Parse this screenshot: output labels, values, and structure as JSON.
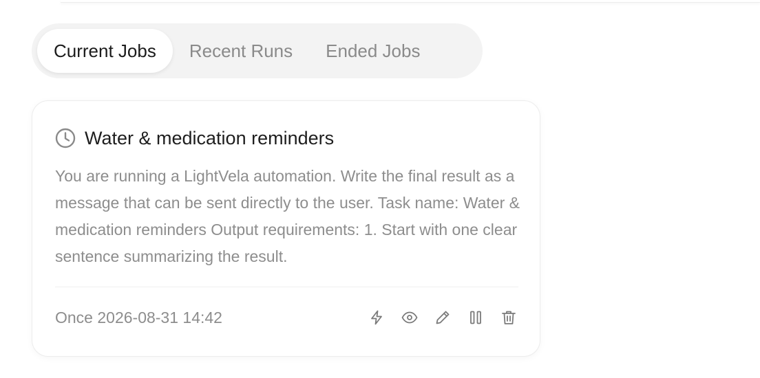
{
  "tabs": [
    {
      "label": "Current Jobs",
      "active": true
    },
    {
      "label": "Recent Runs",
      "active": false
    },
    {
      "label": "Ended Jobs",
      "active": false
    }
  ],
  "job": {
    "icon": "clock-icon",
    "title": "Water & medication reminders",
    "description": "You are running a LightVela automation. Write the final result as a message that can be sent directly to the user. Task name: Water & medication reminders Output requirements: 1. Start with one clear sentence summarizing the result.",
    "schedule": "Once 2026-08-31 14:42",
    "actions": [
      "run-now-icon",
      "view-icon",
      "edit-icon",
      "pause-icon",
      "delete-icon"
    ]
  },
  "colors": {
    "tab_bg": "#f3f3f3",
    "active_tab_bg": "#ffffff",
    "muted_text": "#8d8d8d",
    "title_text": "#1e1e1e",
    "icon_color": "#7a7a7a"
  }
}
